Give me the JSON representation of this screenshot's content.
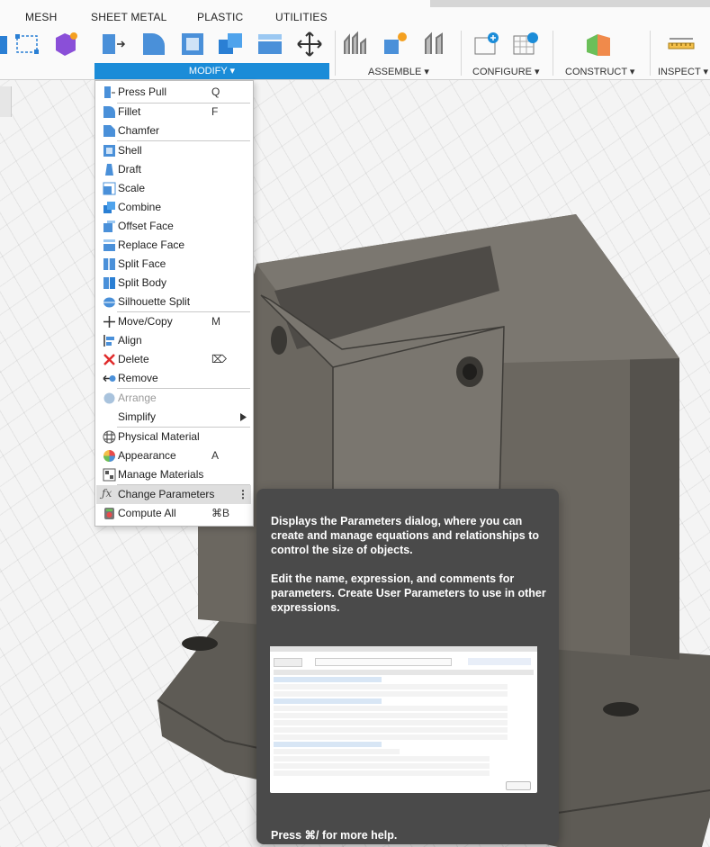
{
  "tabs": [
    "MESH",
    "SHEET METAL",
    "PLASTIC",
    "UTILITIES"
  ],
  "groups": {
    "modify": "MODIFY ▾",
    "assemble": "ASSEMBLE ▾",
    "configure": "CONFIGURE ▾",
    "construct": "CONSTRUCT ▾",
    "inspect": "INSPECT ▾"
  },
  "menu": {
    "items": [
      {
        "label": "Press Pull",
        "shortcut": "Q",
        "icon": "press-pull-icon"
      },
      {
        "label": "Fillet",
        "shortcut": "F",
        "icon": "fillet-icon"
      },
      {
        "label": "Chamfer",
        "shortcut": "",
        "icon": "chamfer-icon"
      },
      {
        "label": "Shell",
        "shortcut": "",
        "icon": "shell-icon"
      },
      {
        "label": "Draft",
        "shortcut": "",
        "icon": "draft-icon"
      },
      {
        "label": "Scale",
        "shortcut": "",
        "icon": "scale-icon"
      },
      {
        "label": "Combine",
        "shortcut": "",
        "icon": "combine-icon"
      },
      {
        "label": "Offset Face",
        "shortcut": "",
        "icon": "offset-face-icon"
      },
      {
        "label": "Replace Face",
        "shortcut": "",
        "icon": "replace-face-icon"
      },
      {
        "label": "Split Face",
        "shortcut": "",
        "icon": "split-face-icon"
      },
      {
        "label": "Split Body",
        "shortcut": "",
        "icon": "split-body-icon"
      },
      {
        "label": "Silhouette Split",
        "shortcut": "",
        "icon": "silhouette-split-icon"
      },
      {
        "label": "Move/Copy",
        "shortcut": "M",
        "icon": "move-copy-icon"
      },
      {
        "label": "Align",
        "shortcut": "",
        "icon": "align-icon"
      },
      {
        "label": "Delete",
        "shortcut": "⌦",
        "icon": "delete-icon"
      },
      {
        "label": "Remove",
        "shortcut": "",
        "icon": "remove-icon"
      },
      {
        "label": "Arrange",
        "shortcut": "",
        "icon": "arrange-icon"
      },
      {
        "label": "Simplify",
        "shortcut": "",
        "icon": "submenu-arrow-icon"
      },
      {
        "label": "Physical Material",
        "shortcut": "",
        "icon": "physical-material-icon"
      },
      {
        "label": "Appearance",
        "shortcut": "A",
        "icon": "appearance-icon"
      },
      {
        "label": "Manage Materials",
        "shortcut": "",
        "icon": "manage-materials-icon"
      },
      {
        "label": "Change Parameters",
        "shortcut": "⋮",
        "icon": "fx-icon"
      },
      {
        "label": "Compute All",
        "shortcut": "⌘B",
        "icon": "compute-all-icon"
      }
    ]
  },
  "tooltip": {
    "para1": "Displays the Parameters dialog, where you can create and manage equations and relationships to control the size of objects.",
    "para2": "Edit the name, expression, and comments for parameters. Create User Parameters to use in other expressions.",
    "footer": "Press ⌘/ for more help."
  },
  "colors": {
    "accent": "#1b8cd8",
    "tooltip_bg": "#4a4a4a",
    "model": "#6b6760"
  }
}
